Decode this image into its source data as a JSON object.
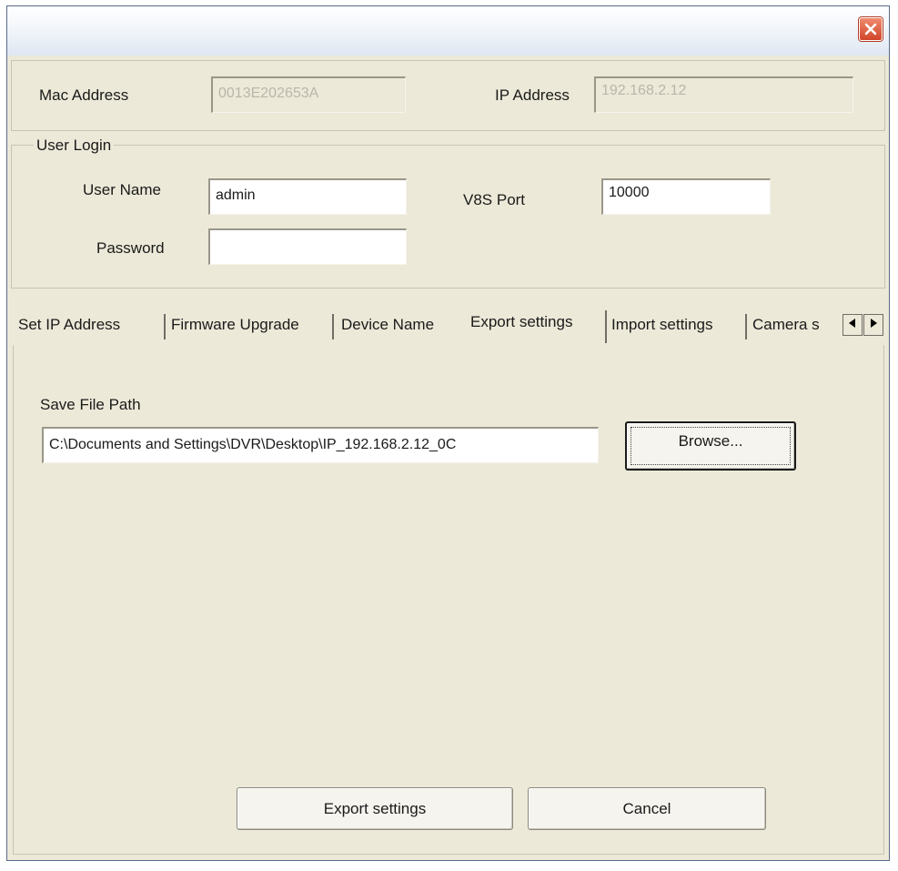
{
  "window": {
    "title": ""
  },
  "device": {
    "mac_label": "Mac Address",
    "mac_value": "0013E202653A",
    "ip_label": "IP Address",
    "ip_value": "192.168.2.12"
  },
  "login": {
    "group_title": "User Login",
    "username_label": "User Name",
    "username_value": "admin",
    "password_label": "Password",
    "password_value": "",
    "port_label": "V8S Port",
    "port_value": "10000"
  },
  "tabs": [
    {
      "label": "Set IP Address"
    },
    {
      "label": "Firmware Upgrade"
    },
    {
      "label": "Device Name"
    },
    {
      "label": "Export settings",
      "active": true
    },
    {
      "label": "Import settings"
    },
    {
      "label": "Camera s"
    }
  ],
  "export": {
    "path_label": "Save File Path",
    "path_value": "C:\\Documents and Settings\\DVR\\Desktop\\IP_192.168.2.12_0C",
    "browse_label": "Browse...",
    "export_label": "Export settings",
    "cancel_label": "Cancel"
  },
  "icons": {
    "close": "close-icon",
    "scroll_left": "arrow-left-icon",
    "scroll_right": "arrow-right-icon"
  },
  "colors": {
    "window_bg": "#ece9d8",
    "close_button": "#d1452a"
  }
}
